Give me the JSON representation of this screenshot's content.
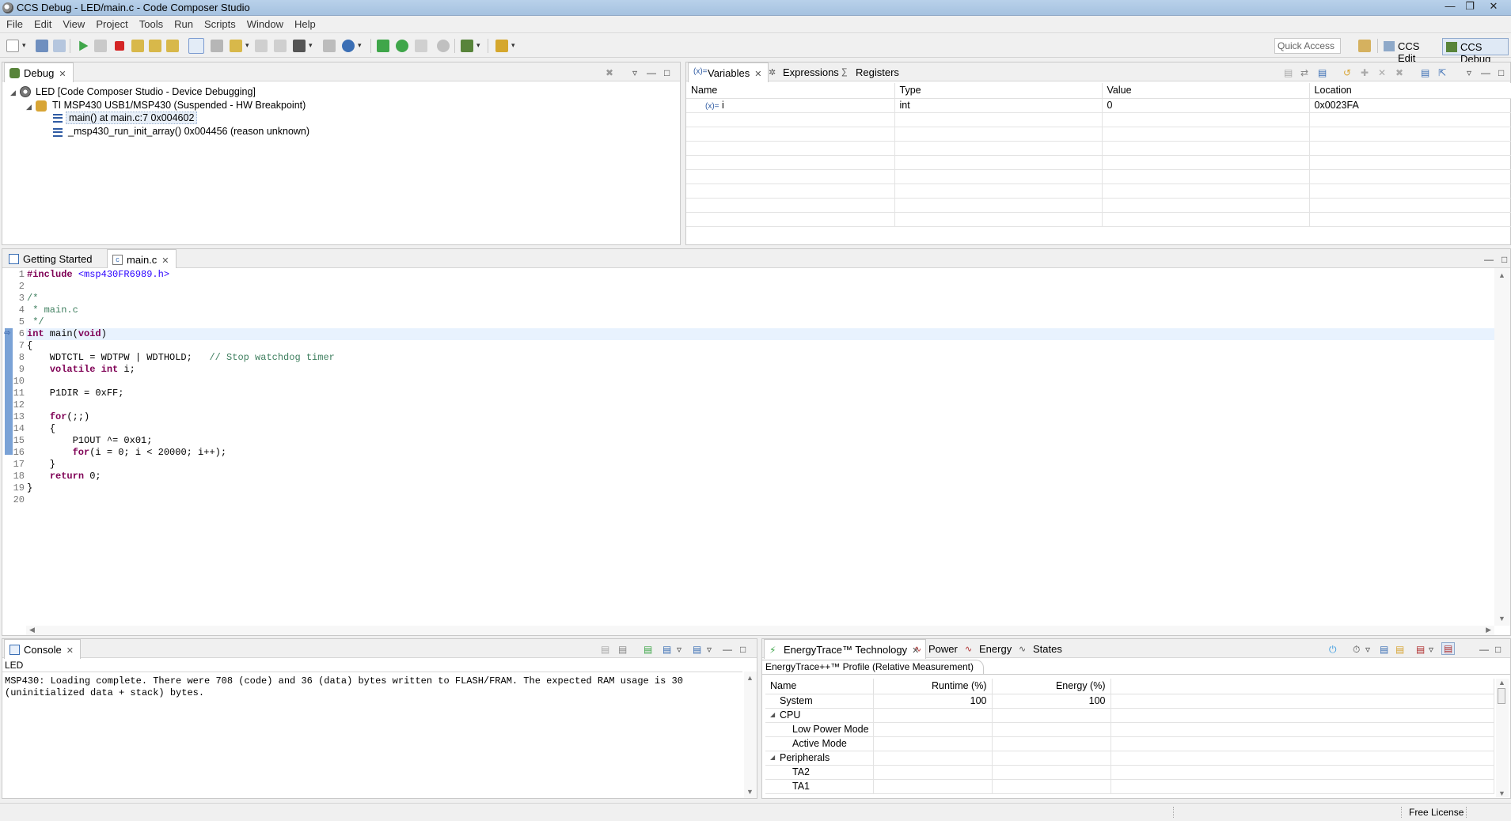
{
  "window": {
    "title": "CCS Debug - LED/main.c - Code Composer Studio"
  },
  "menu": [
    "File",
    "Edit",
    "View",
    "Project",
    "Tools",
    "Run",
    "Scripts",
    "Window",
    "Help"
  ],
  "toolbar": {
    "quick_access_placeholder": "Quick Access",
    "perspectives": [
      "CCS Edit",
      "CCS Debug"
    ]
  },
  "debug_view": {
    "tab_label": "Debug",
    "tree": [
      "LED [Code Composer Studio - Device Debugging]",
      "TI MSP430 USB1/MSP430 (Suspended - HW Breakpoint)",
      "main() at main.c:7 0x004602",
      "_msp430_run_init_array() 0x004456  (reason unknown)"
    ]
  },
  "variables_view": {
    "tabs": [
      "Variables",
      "Expressions",
      "Registers"
    ],
    "columns": [
      "Name",
      "Type",
      "Value",
      "Location"
    ],
    "rows": [
      {
        "name": "i",
        "type": "int",
        "value": "0",
        "location": "0x0023FA"
      }
    ]
  },
  "editor": {
    "tabs": [
      "Getting Started",
      "main.c"
    ],
    "lines": [
      "#include <msp430FR6989.h>",
      "",
      "/*",
      " * main.c",
      " */",
      "int main(void)",
      "{",
      "    WDTCTL = WDTPW | WDTHOLD;   // Stop watchdog timer",
      "    volatile int i;",
      "",
      "    P1DIR = 0xFF;",
      "",
      "    for(;;)",
      "    {",
      "        P1OUT ^= 0x01;",
      "        for(i = 0; i < 20000; i++);",
      "    }",
      "    return 0;",
      "}",
      ""
    ],
    "current_line": 7
  },
  "console": {
    "tab_label": "Console",
    "context": "LED",
    "lines": [
      "MSP430: Loading complete. There were 708 (code) and 36 (data) bytes written to FLASH/FRAM. The expected RAM usage is 30",
      "(uninitialized data + stack) bytes."
    ]
  },
  "energytrace": {
    "tabs": [
      "EnergyTrace™ Technology",
      "Power",
      "Energy",
      "States"
    ],
    "profile_tab": "EnergyTrace++™ Profile (Relative Measurement)",
    "columns": [
      "Name",
      "Runtime (%)",
      "Energy (%)"
    ],
    "rows": [
      {
        "name": "System",
        "runtime": "100",
        "energy": "100",
        "indent": 0,
        "expander": ""
      },
      {
        "name": "CPU",
        "runtime": "",
        "energy": "",
        "indent": 0,
        "expander": "◢"
      },
      {
        "name": "Low Power Mode",
        "runtime": "",
        "energy": "",
        "indent": 1,
        "expander": ""
      },
      {
        "name": "Active Mode",
        "runtime": "",
        "energy": "",
        "indent": 1,
        "expander": ""
      },
      {
        "name": "Peripherals",
        "runtime": "",
        "energy": "",
        "indent": 0,
        "expander": "◢"
      },
      {
        "name": "TA2",
        "runtime": "",
        "energy": "",
        "indent": 1,
        "expander": ""
      },
      {
        "name": "TA1",
        "runtime": "",
        "energy": "",
        "indent": 1,
        "expander": ""
      }
    ]
  },
  "status": {
    "license": "Free License"
  },
  "colors": {
    "keyword": "#7f0055",
    "include": "#2a00ff",
    "comment": "#3f7f5f",
    "highlight": "#e8f2fe"
  }
}
